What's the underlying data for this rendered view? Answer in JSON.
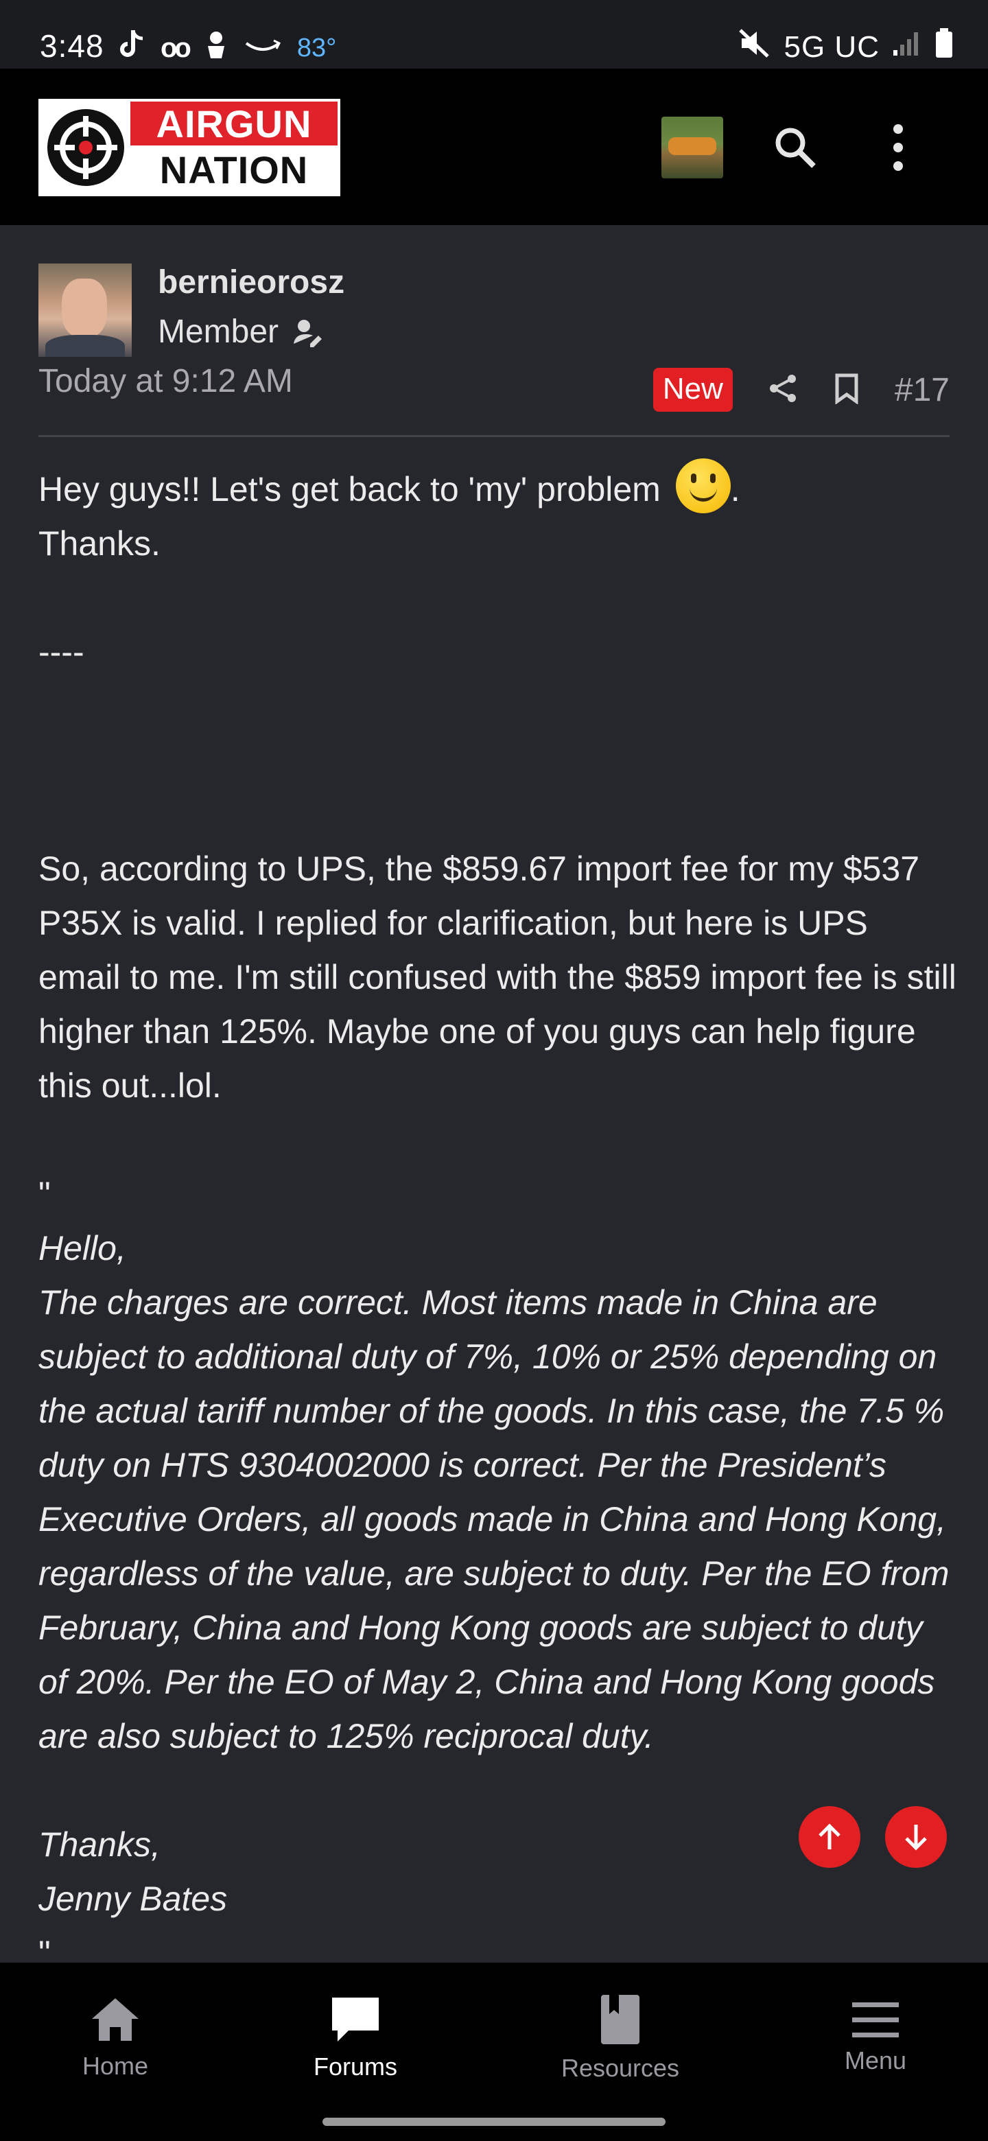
{
  "status_bar": {
    "time": "3:48",
    "voicemail_glyph": "oo",
    "temperature": "83°",
    "network": "5G UC"
  },
  "header": {
    "logo_top": "AIRGUN",
    "logo_bottom": "NATION"
  },
  "post": {
    "username": "bernieorosz",
    "role": "Member",
    "timestamp": "Today at 9:12 AM",
    "badge": "New",
    "number": "#17",
    "line1": "Hey guys!! Let's get back to 'my' problem",
    "line1_end": ".",
    "line2": "Thanks.",
    "separator": "----",
    "paragraph": "So, according to UPS, the $859.67 import fee for my $537 P35X is valid. I replied for clarification, but here is UPS email to me. I'm still confused with the $859 import fee is still higher than 125%. Maybe one of you guys can help figure this out...lol.",
    "quote_open": "\"",
    "email_greeting": "Hello,",
    "email_body": "The charges are correct. Most items made in China are subject to additional duty of 7%, 10% or 25% depending on the actual tariff number of the goods. In this case, the 7.5 % duty on HTS 9304002000 is correct. Per the President’s Executive Orders, all goods made in China and Hong Kong, regardless of the value, are subject to duty. Per the EO from February, China and Hong Kong goods are subject to duty of 20%. Per the EO of May 2, China and Hong Kong goods are also subject to 125% reciprocal duty.",
    "email_signoff": "Thanks,",
    "email_name": "Jenny Bates",
    "quote_close": "\""
  },
  "bottom_nav": {
    "items": [
      {
        "label": "Home",
        "icon": "home-icon",
        "active": false
      },
      {
        "label": "Forums",
        "icon": "chat-bubble-icon",
        "active": true
      },
      {
        "label": "Resources",
        "icon": "book-icon",
        "active": false
      },
      {
        "label": "Menu",
        "icon": "hamburger-icon",
        "active": false
      }
    ]
  },
  "colors": {
    "accent": "#e22024",
    "background": "#26272c",
    "header": "#000000"
  }
}
